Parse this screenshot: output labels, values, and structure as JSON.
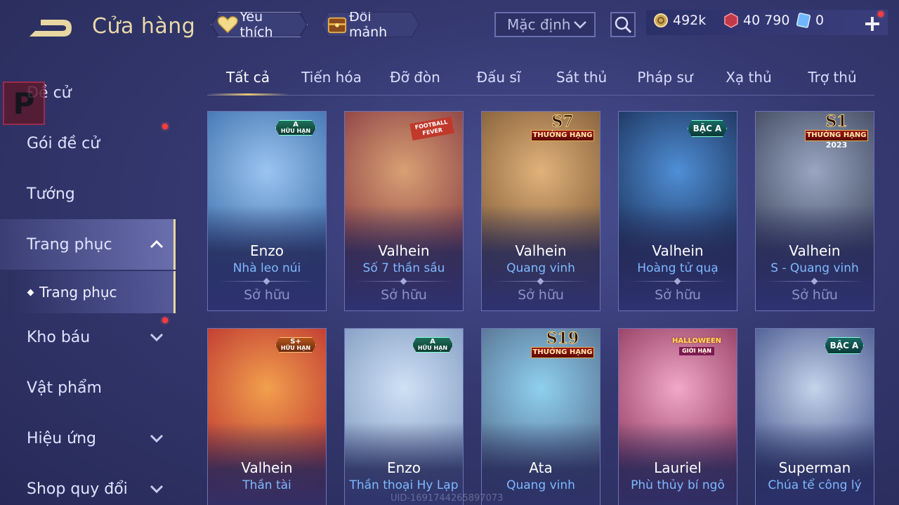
{
  "header": {
    "title": "Cửa hàng",
    "favorite_label": "Yêu thích",
    "shard_label": "Đổi mảnh",
    "sort_value": "Mặc định",
    "currencies": [
      {
        "icon": "gold-coin-icon",
        "value": "492k"
      },
      {
        "icon": "red-voucher-icon",
        "value": "40 790"
      },
      {
        "icon": "blue-ticket-icon",
        "value": "0"
      }
    ]
  },
  "sidebar": {
    "items": [
      {
        "label": "Đề cử"
      },
      {
        "label": "Gói đề cử"
      },
      {
        "label": "Tướng"
      },
      {
        "label": "Trang phục"
      },
      {
        "label": "Kho báu"
      },
      {
        "label": "Vật phẩm"
      },
      {
        "label": "Hiệu ứng"
      },
      {
        "label": "Shop quy đổi"
      }
    ],
    "sub_item": "Trang phục",
    "logo_letter": "P"
  },
  "tabs": [
    "Tất cả",
    "Tiến hóa",
    "Đỡ đòn",
    "Đấu sĩ",
    "Sát thủ",
    "Pháp sư",
    "Xạ thủ",
    "Trợ thủ"
  ],
  "badges": {
    "a_limited": {
      "grade": "A",
      "text": "HỮU HẠN"
    },
    "splus_limited": {
      "grade": "S+",
      "text": "HỮU HẠN"
    },
    "football": "FOOTBALL FEVER",
    "s7": {
      "season": "S7",
      "rank": "THƯỞNG HẠNG"
    },
    "s1": {
      "season": "S1",
      "rank": "THƯỞNG HẠNG",
      "year": "2023"
    },
    "s19": {
      "season": "S19",
      "rank": "THƯỞNG HẠNG"
    },
    "bac_a": "BẬC A",
    "halloween": {
      "text": "HALLOWEEN",
      "sub": "GIỚI HẠN"
    }
  },
  "cards": [
    {
      "hero": "Enzo",
      "skin": "Nhà leo núi",
      "status": "Sở hữu",
      "colors": [
        "#9bc5f0",
        "#2b5fa0"
      ]
    },
    {
      "hero": "Valhein",
      "skin": "Số 7 thần sầu",
      "status": "Sở hữu",
      "colors": [
        "#d9a074",
        "#7a2a3a"
      ]
    },
    {
      "hero": "Valhein",
      "skin": "Quang vinh",
      "status": "Sở hữu",
      "colors": [
        "#e2b27a",
        "#6b4a2a"
      ]
    },
    {
      "hero": "Valhein",
      "skin": "Hoàng tử quạ",
      "status": "Sở hữu",
      "colors": [
        "#4f8fd6",
        "#101c3e"
      ]
    },
    {
      "hero": "Valhein",
      "skin": "S - Quang vinh",
      "status": "Sở hữu",
      "colors": [
        "#9aa6c2",
        "#2b3348"
      ]
    },
    {
      "hero": "Valhein",
      "skin": "Thần tài",
      "status": "",
      "colors": [
        "#f2a04e",
        "#b21e2a"
      ]
    },
    {
      "hero": "Enzo",
      "skin": "Thần thoại Hy Lạp",
      "status": "",
      "colors": [
        "#cfe1f5",
        "#6f8bb6"
      ]
    },
    {
      "hero": "Ata",
      "skin": "Quang vinh",
      "status": "",
      "colors": [
        "#8fd0f0",
        "#4a5a78"
      ]
    },
    {
      "hero": "Lauriel",
      "skin": "Phù thủy bí ngô",
      "status": "",
      "colors": [
        "#f2a8c8",
        "#7a2248"
      ]
    },
    {
      "hero": "Superman",
      "skin": "Chúa tể công lý",
      "status": "",
      "colors": [
        "#c5d4ea",
        "#2a3b7a"
      ]
    }
  ],
  "uid_watermark": "UID-1691744265897073",
  "colors": {
    "accent_gold": "#e8d7a2",
    "skin_blue": "#7fb9ff",
    "notification_red": "#ff3b3b"
  }
}
